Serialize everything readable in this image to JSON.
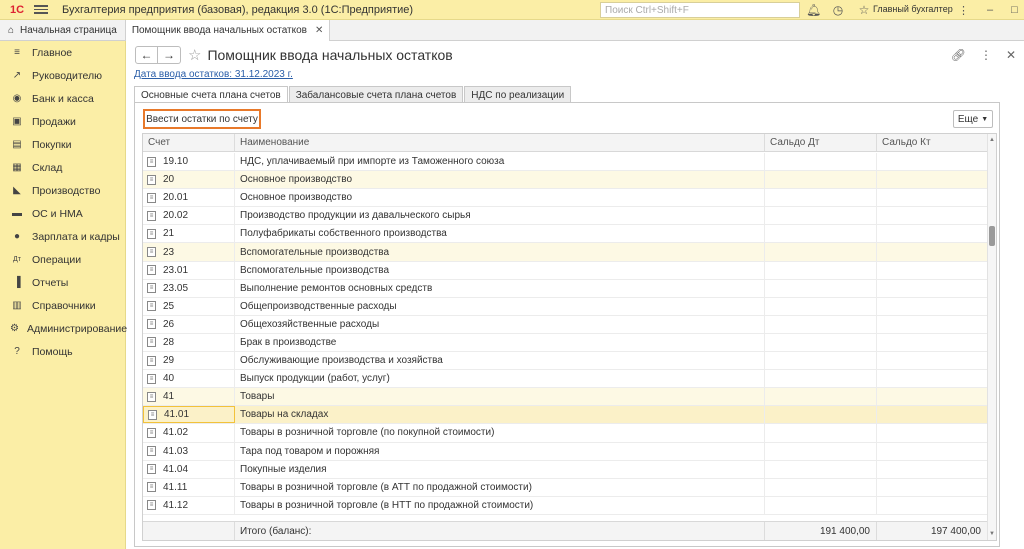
{
  "titlebar": {
    "logo": "1С",
    "app_title": "Бухгалтерия предприятия (базовая), редакция 3.0  (1С:Предприятие)",
    "search_placeholder": "Поиск Ctrl+Shift+F",
    "user": "Главный бухгалтер"
  },
  "tabbar": {
    "home_label": "Начальная страница",
    "doc_tab_label": "Помощник ввода начальных остатков"
  },
  "sidebar": {
    "items": [
      {
        "label": "Главное",
        "icon": "menu-icon"
      },
      {
        "label": "Руководителю",
        "icon": "trend-icon"
      },
      {
        "label": "Банк и касса",
        "icon": "coin-icon"
      },
      {
        "label": "Продажи",
        "icon": "bag-icon"
      },
      {
        "label": "Покупки",
        "icon": "cart-icon"
      },
      {
        "label": "Склад",
        "icon": "warehouse-icon"
      },
      {
        "label": "Производство",
        "icon": "factory-icon"
      },
      {
        "label": "ОС и НМА",
        "icon": "truck-icon"
      },
      {
        "label": "Зарплата и кадры",
        "icon": "person-icon"
      },
      {
        "label": "Операции",
        "icon": "dt-kt-icon"
      },
      {
        "label": "Отчеты",
        "icon": "report-icon"
      },
      {
        "label": "Справочники",
        "icon": "book-icon"
      },
      {
        "label": "Администрирование",
        "icon": "gear-icon"
      },
      {
        "label": "Помощь",
        "icon": "question-icon"
      }
    ]
  },
  "form": {
    "title": "Помощник ввода начальных остатков",
    "date_link": "Дата ввода остатков: 31.12.2023 г.",
    "tabs": [
      {
        "label": "Основные счета плана счетов",
        "active": true
      },
      {
        "label": "Забалансовые счета плана счетов",
        "active": false
      },
      {
        "label": "НДС по реализации",
        "active": false
      }
    ],
    "enter_button": "Ввести остатки по счету",
    "more_button": "Еще"
  },
  "grid": {
    "columns": [
      "Счет",
      "Наименование",
      "Сальдо Дт",
      "Сальдо Кт"
    ],
    "rows": [
      {
        "account": "19.10",
        "name": "НДС, уплачиваемый при импорте из Таможенного союза",
        "state": ""
      },
      {
        "account": "20",
        "name": "Основное производство",
        "state": "hl"
      },
      {
        "account": "20.01",
        "name": "Основное производство",
        "state": ""
      },
      {
        "account": "20.02",
        "name": "Производство продукции из давальческого сырья",
        "state": ""
      },
      {
        "account": "21",
        "name": "Полуфабрикаты собственного производства",
        "state": ""
      },
      {
        "account": "23",
        "name": "Вспомогательные производства",
        "state": "hl"
      },
      {
        "account": "23.01",
        "name": "Вспомогательные производства",
        "state": ""
      },
      {
        "account": "23.05",
        "name": "Выполнение ремонтов основных средств",
        "state": ""
      },
      {
        "account": "25",
        "name": "Общепроизводственные расходы",
        "state": ""
      },
      {
        "account": "26",
        "name": "Общехозяйственные расходы",
        "state": ""
      },
      {
        "account": "28",
        "name": "Брак в производстве",
        "state": ""
      },
      {
        "account": "29",
        "name": "Обслуживающие производства и хозяйства",
        "state": ""
      },
      {
        "account": "40",
        "name": "Выпуск продукции (работ, услуг)",
        "state": ""
      },
      {
        "account": "41",
        "name": "Товары",
        "state": "hl"
      },
      {
        "account": "41.01",
        "name": "Товары на складах",
        "state": "sel"
      },
      {
        "account": "41.02",
        "name": "Товары в розничной торговле (по покупной стоимости)",
        "state": ""
      },
      {
        "account": "41.03",
        "name": "Тара под товаром и порожняя",
        "state": ""
      },
      {
        "account": "41.04",
        "name": "Покупные изделия",
        "state": ""
      },
      {
        "account": "41.11",
        "name": "Товары в розничной торговле (в АТТ по продажной стоимости)",
        "state": ""
      },
      {
        "account": "41.12",
        "name": "Товары в розничной торговле (в НТТ по продажной стоимости)",
        "state": ""
      }
    ],
    "footer": {
      "label": "Итого (баланс):",
      "debit": "191 400,00",
      "credit": "197 400,00"
    }
  }
}
